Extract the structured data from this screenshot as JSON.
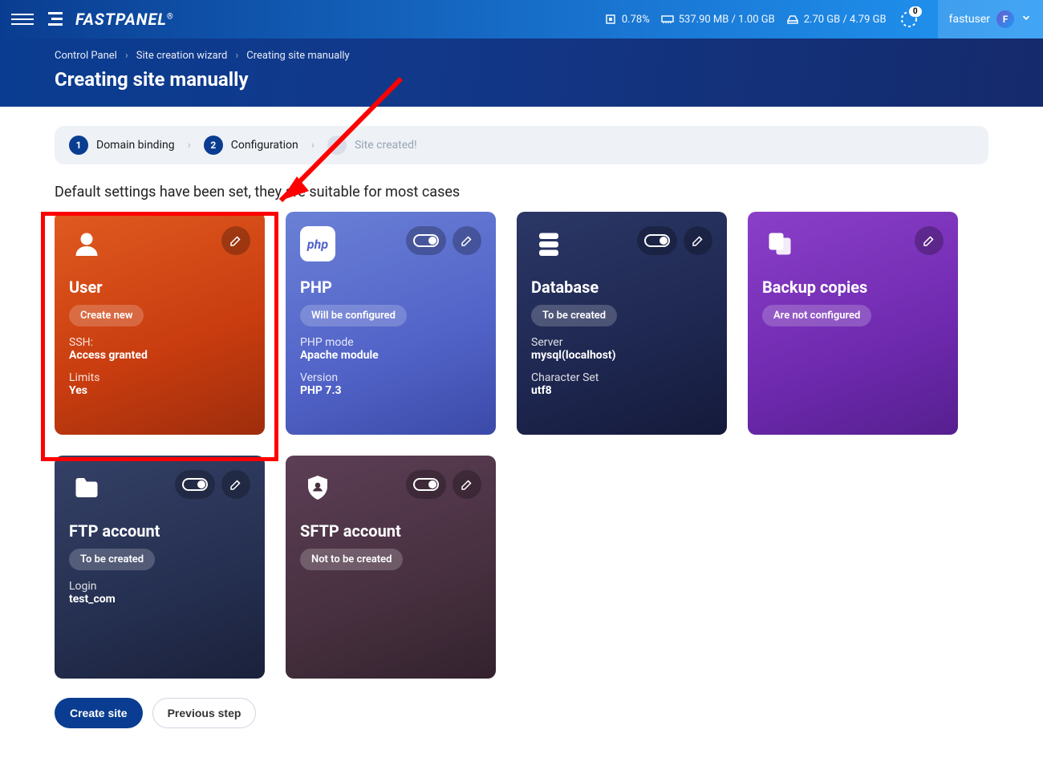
{
  "topbar": {
    "logo_text": "FASTPANEL",
    "cpu": "0.78%",
    "mem": "537.90 MB / 1.00 GB",
    "disk": "2.70 GB / 4.79 GB",
    "notif_count": "0",
    "username": "fastuser",
    "avatar_initial": "F"
  },
  "breadcrumb": {
    "a": "Control Panel",
    "b": "Site creation wizard",
    "c": "Creating site manually"
  },
  "page_title": "Creating site manually",
  "stepper": {
    "step1_num": "1",
    "step1_label": "Domain binding",
    "step2_num": "2",
    "step2_label": "Configuration",
    "step3_label": "Site created!"
  },
  "subheading": "Default settings have been set, they are suitable for most cases",
  "cards": {
    "user": {
      "title": "User",
      "badge": "Create new",
      "ssh_k": "SSH:",
      "ssh_v": "Access granted",
      "lim_k": "Limits",
      "lim_v": "Yes"
    },
    "php": {
      "title": "PHP",
      "badge": "Will be configured",
      "mode_k": "PHP mode",
      "mode_v": "Apache module",
      "ver_k": "Version",
      "ver_v": "PHP 7.3",
      "icon_label": "php"
    },
    "db": {
      "title": "Database",
      "badge": "To be created",
      "srv_k": "Server",
      "srv_v": "mysql(localhost)",
      "cs_k": "Character Set",
      "cs_v": "utf8"
    },
    "backup": {
      "title": "Backup copies",
      "badge": "Are not configured"
    },
    "ftp": {
      "title": "FTP account",
      "badge": "To be created",
      "login_k": "Login",
      "login_v": "test_com"
    },
    "sftp": {
      "title": "SFTP account",
      "badge": "Not to be created"
    }
  },
  "buttons": {
    "primary": "Create site",
    "secondary": "Previous step"
  }
}
